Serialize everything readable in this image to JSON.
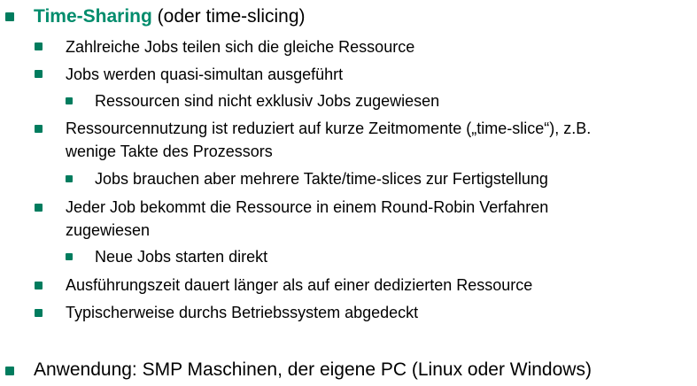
{
  "colors": {
    "accent": "#008c6c",
    "bullet": "#007c5e",
    "text": "#000000"
  },
  "heading": {
    "term": "Time-Sharing",
    "suffix": " (oder time-slicing)"
  },
  "items": {
    "i1": "Zahlreiche Jobs teilen sich die gleiche Ressource",
    "i2": "Jobs werden quasi-simultan ausgeführt",
    "i2_sub1": "Ressourcen sind nicht exklusiv Jobs zugewiesen",
    "i3_line1": "Ressourcennutzung ist reduziert auf kurze Zeitmomente („time-slice“), z.B.",
    "i3_line2": "wenige Takte des Prozessors",
    "i3_sub1": "Jobs brauchen aber mehrere Takte/time-slices zur Fertigstellung",
    "i4_line1": "Jeder Job bekommt die Ressource in einem Round-Robin Verfahren",
    "i4_line2": "zugewiesen",
    "i4_sub1": "Neue Jobs starten direkt",
    "i5": "Ausführungszeit dauert länger als auf einer dedizierten Ressource",
    "i6": "Typischerweise durchs Betriebssystem abgedeckt"
  },
  "application": "Anwendung: SMP Maschinen, der eigene PC (Linux oder Windows)"
}
